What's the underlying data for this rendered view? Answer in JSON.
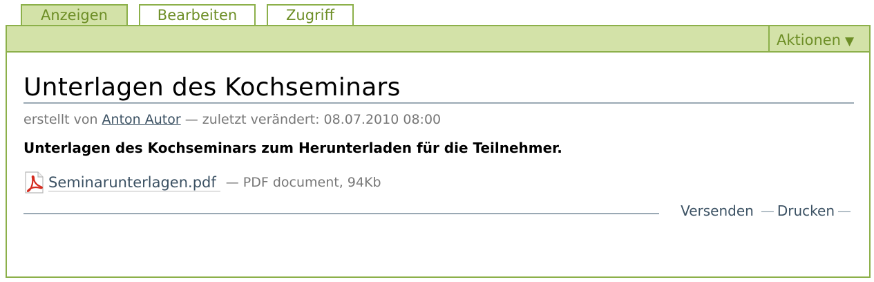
{
  "tabs": [
    {
      "label": "Anzeigen",
      "selected": true
    },
    {
      "label": "Bearbeiten",
      "selected": false
    },
    {
      "label": "Zugriff",
      "selected": false
    }
  ],
  "actions": {
    "label": "Aktionen",
    "arrow": "▼"
  },
  "document": {
    "title": "Unterlagen des Kochseminars",
    "byline": {
      "prefix": "erstellt von",
      "author": "Anton Autor",
      "modified": "— zuletzt verändert: 08.07.2010 08:00"
    },
    "description": "Unterlagen des Kochseminars zum Herunterladen für die Teilnehmer.",
    "file": {
      "icon": "pdf-icon",
      "name": "Seminarunterlagen.pdf",
      "meta": "— PDF document, 94Kb"
    }
  },
  "document_actions": {
    "send": "Versenden",
    "print": "Drucken",
    "separator": "—"
  },
  "colors": {
    "accent_green": "#8cb04a",
    "bar_green": "#d3e2a8",
    "tab_text": "#6d8e26",
    "link": "#3b5163",
    "rule": "#9aa9b4"
  }
}
